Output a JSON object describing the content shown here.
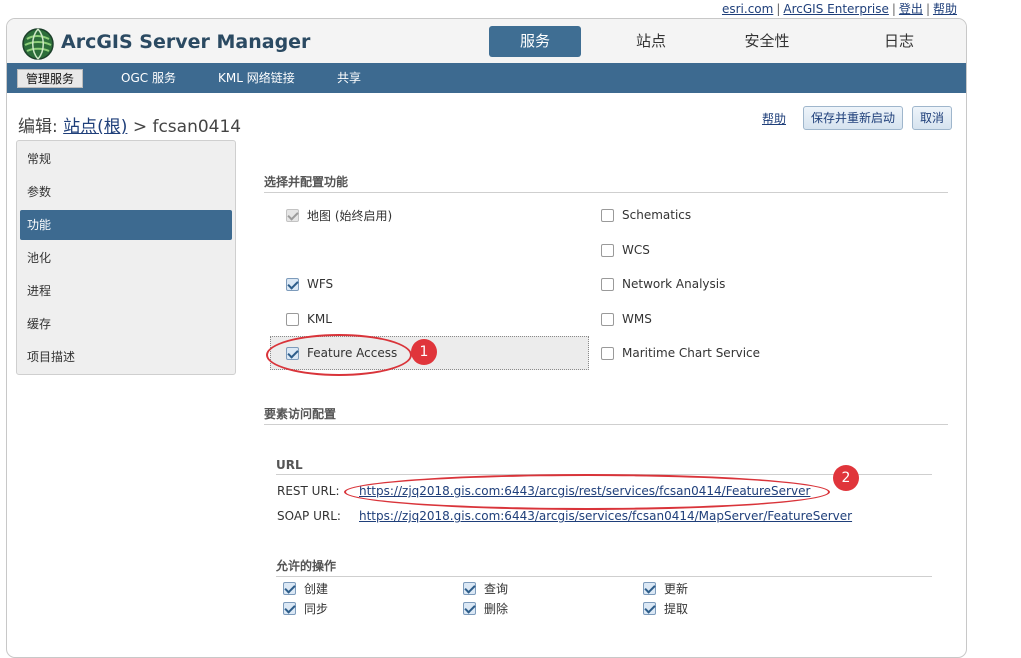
{
  "top_links": {
    "esri": "esri.com",
    "enterprise": "ArcGIS Enterprise",
    "logout": "登出",
    "help": "帮助"
  },
  "app": {
    "title": "ArcGIS Server Manager"
  },
  "main_tabs": [
    {
      "label": "服务",
      "active": true
    },
    {
      "label": "站点",
      "active": false
    },
    {
      "label": "安全性",
      "active": false
    },
    {
      "label": "日志",
      "active": false
    }
  ],
  "sub_nav": [
    {
      "label": "管理服务",
      "active": true
    },
    {
      "label": "OGC 服务",
      "active": false
    },
    {
      "label": "KML 网络链接",
      "active": false
    },
    {
      "label": "共享",
      "active": false
    }
  ],
  "breadcrumb": {
    "prefix": "编辑:",
    "root_link": "站点(根)",
    "separator": ">",
    "service": "fcsan0414"
  },
  "actions": {
    "help": "帮助",
    "save_restart": "保存并重新启动",
    "cancel": "取消"
  },
  "left_menu": [
    {
      "label": "常规",
      "active": false
    },
    {
      "label": "参数",
      "active": false
    },
    {
      "label": "功能",
      "active": true
    },
    {
      "label": "池化",
      "active": false
    },
    {
      "label": "进程",
      "active": false
    },
    {
      "label": "缓存",
      "active": false
    },
    {
      "label": "项目描述",
      "active": false
    }
  ],
  "capabilities": {
    "heading": "选择并配置功能",
    "left": [
      {
        "label": "地图 (始终启用)",
        "checked": true,
        "disabled": true
      },
      {
        "label": "WFS",
        "checked": true,
        "disabled": false
      },
      {
        "label": "KML",
        "checked": false,
        "disabled": false
      },
      {
        "label": "Feature Access",
        "checked": true,
        "disabled": false
      }
    ],
    "right": [
      {
        "label": "Schematics",
        "checked": false
      },
      {
        "label": "WCS",
        "checked": false
      },
      {
        "label": "Network Analysis",
        "checked": false
      },
      {
        "label": "WMS",
        "checked": false
      },
      {
        "label": "Maritime Chart Service",
        "checked": false
      }
    ]
  },
  "feature_access": {
    "heading": "要素访问配置",
    "url_heading": "URL",
    "rest_label": "REST URL:",
    "rest_url": "https://zjq2018.gis.com:6443/arcgis/rest/services/fcsan0414/FeatureServer",
    "soap_label": "SOAP URL:",
    "soap_url": "https://zjq2018.gis.com:6443/arcgis/services/fcsan0414/MapServer/FeatureServer",
    "ops_heading": "允许的操作",
    "operations": [
      {
        "label": "创建",
        "checked": true
      },
      {
        "label": "查询",
        "checked": true
      },
      {
        "label": "更新",
        "checked": true
      },
      {
        "label": "同步",
        "checked": true
      },
      {
        "label": "删除",
        "checked": true
      },
      {
        "label": "提取",
        "checked": true
      }
    ]
  },
  "annotations": {
    "one": "1",
    "two": "2",
    "color": "#d9343a"
  }
}
